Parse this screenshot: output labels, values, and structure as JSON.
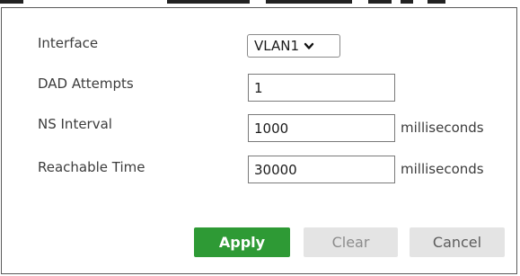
{
  "form": {
    "interface_label": "Interface",
    "interface_value": "VLAN1",
    "dad_label": "DAD Attempts",
    "dad_value": "1",
    "ns_label": "NS Interval",
    "ns_value": "1000",
    "ns_unit": "milliseconds",
    "reachable_label": "Reachable Time",
    "reachable_value": "30000",
    "reachable_unit": "milliseconds"
  },
  "buttons": {
    "apply": "Apply",
    "clear": "Clear",
    "cancel": "Cancel"
  },
  "colors": {
    "apply_bg": "#2e9a35",
    "secondary_bg": "#e4e4e4",
    "border": "#5a5a5a"
  },
  "icons": {
    "dropdown": "chevron-down-icon"
  }
}
